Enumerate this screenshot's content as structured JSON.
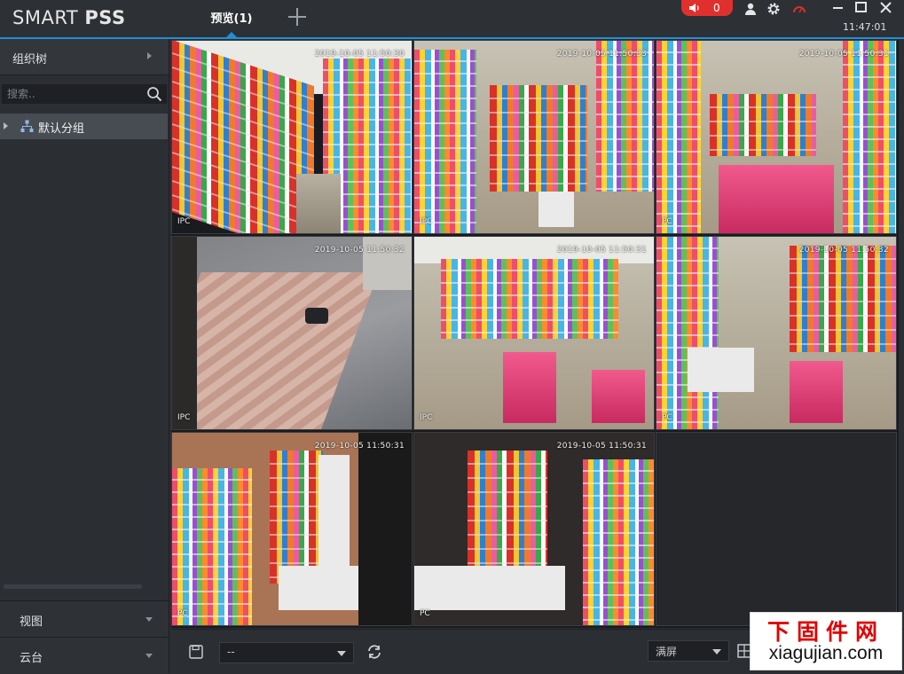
{
  "app": {
    "logo_light": "SMART ",
    "logo_bold": "PSS",
    "tab_label": "预览(1)",
    "alarm_count": "0",
    "clock": "11:47:01",
    "accent_color": "#1f8fd6",
    "alarm_color": "#e0302e"
  },
  "sidebar": {
    "org_tree_title": "组织树",
    "search_placeholder": "搜索..",
    "tree_items": [
      {
        "label": "默认分组"
      }
    ],
    "panels": [
      {
        "label": "视图"
      },
      {
        "label": "云台"
      }
    ]
  },
  "video_grid": {
    "cells": [
      {
        "timestamp": "2019-10-05 11:50:30",
        "camera_label": "IPC"
      },
      {
        "timestamp": "2019-10-05 11:50:33",
        "camera_label": "IPC"
      },
      {
        "timestamp": "2019-10-05 11:50:31",
        "camera_label": "PC"
      },
      {
        "timestamp": "2019-10-05 11:50:32",
        "camera_label": "IPC"
      },
      {
        "timestamp": "2019-10-05 11:50:31",
        "camera_label": "IPC"
      },
      {
        "timestamp": "2019-10-05 11:50:32",
        "camera_label": "PC"
      },
      {
        "timestamp": "2019-10-05 11:50:31",
        "camera_label": "PC"
      },
      {
        "timestamp": "2019-10-05 11:50:31",
        "camera_label": "PC"
      }
    ]
  },
  "toolbar": {
    "view_select_value": "--",
    "screen_select_value": "满屏"
  },
  "watermark": {
    "cn": "下固件网",
    "en": "xiagujian.com"
  }
}
